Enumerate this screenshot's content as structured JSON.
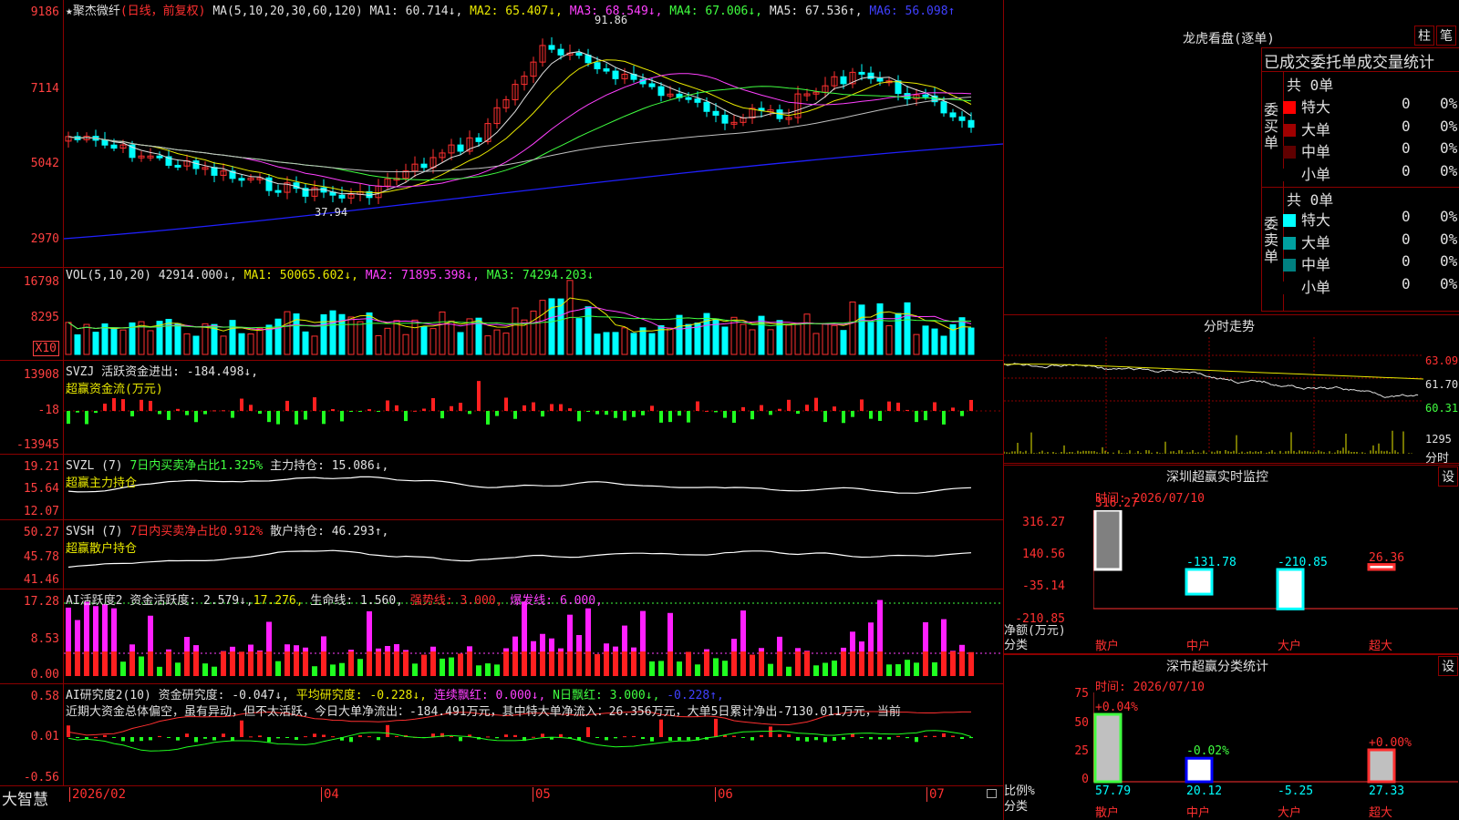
{
  "main": {
    "y_ticks": [
      "9186",
      "7114",
      "5042",
      "2970"
    ],
    "header": {
      "star": "★",
      "name": "聚杰微纤",
      "period": "(日线，前复权)",
      "ma_label": "MA(5,10,20,30,60,120)",
      "ma1": "MA1: 60.714↓,",
      "ma2": "MA2: 65.407↓,",
      "ma3": "MA3: 68.549↓,",
      "ma4": "MA4: 67.006↓,",
      "ma5": "MA5: 67.536↑,",
      "ma6": "MA6: 56.098↑"
    },
    "high_label": "91.86",
    "low_label": "37.94"
  },
  "vol": {
    "y_ticks": [
      "16798",
      "8295"
    ],
    "unit": "X10",
    "header": {
      "label": "VOL(5,10,20)",
      "val": "42914.000↓,",
      "ma1": "MA1: 50065.602↓,",
      "ma2": "MA2: 71895.398↓,",
      "ma3": "MA3: 74294.203↓"
    }
  },
  "svzj": {
    "y_ticks": [
      "13908",
      "-18",
      "-13945"
    ],
    "header": {
      "label": "SVZJ",
      "text": "活跃资金进出: -184.498↓,",
      "sub": "超赢资金流(万元)"
    }
  },
  "svzl": {
    "y_ticks": [
      "19.21",
      "15.64",
      "12.07"
    ],
    "header": {
      "label": "SVZL (7)",
      "text1": "7日内买卖净占比1.325%",
      "text2": "主力持仓: 15.086↓,",
      "sub": "超赢主力持仓"
    }
  },
  "svsh": {
    "y_ticks": [
      "50.27",
      "45.78",
      "41.46"
    ],
    "header": {
      "label": "SVSH (7)",
      "text1": "7日内买卖净占比0.912%",
      "text2": "散户持仓: 46.293↑,",
      "sub": "超赢散户持仓"
    }
  },
  "ai2": {
    "y_ticks": [
      "17.28",
      "8.53",
      "0.00"
    ],
    "header": {
      "label": "AI活跃度2",
      "t1": "资金活跃度: 2.579↓,",
      "t2": "17.276,",
      "t3": "生命线: 1.560,",
      "t4": "强势线: 3.000,",
      "t5": "爆发线: 6.000,"
    }
  },
  "ai_r": {
    "y_ticks": [
      "0.58",
      "0.01",
      "-0.56"
    ],
    "header": {
      "label": "AI研究度2(10)",
      "t1": "资金研究度: -0.047↓,",
      "t2": "平均研究度: -0.228↓,",
      "t3": "连续飘红: 0.000↓,",
      "t4": "N日飘红: 3.000↓,",
      "t5": "-0.228↑,"
    },
    "comment": "近期大资金总体偏空，虽有异动，但不太活跃，今日大单净流出：-184.491万元，其中特大单净流入：26.356万元，大单5日累计净出-7130.011万元，当前"
  },
  "xaxis": {
    "brand": "大智慧",
    "labels": [
      "2026/02",
      "04",
      "05",
      "06",
      "07"
    ]
  },
  "lhb": {
    "title": "龙虎看盘(逐单)",
    "btn1": "柱",
    "btn2": "笔",
    "col_header": "已成交委托单成交量统计",
    "buy_label": "委买单",
    "sell_label": "委卖单",
    "buy_total": "共 0单",
    "sell_total": "共 0单",
    "buy_rows": [
      {
        "name": "特大",
        "val": "0",
        "pct": "0%",
        "color": "#ff0000"
      },
      {
        "name": "大单",
        "val": "0",
        "pct": "0%",
        "color": "#a00000"
      },
      {
        "name": "中单",
        "val": "0",
        "pct": "0%",
        "color": "#600000"
      },
      {
        "name": "小单",
        "val": "0",
        "pct": "0%",
        "color": "#000000"
      }
    ],
    "sell_rows": [
      {
        "name": "特大",
        "val": "0",
        "pct": "0%",
        "color": "#00ffff"
      },
      {
        "name": "大单",
        "val": "0",
        "pct": "0%",
        "color": "#00a0a0"
      },
      {
        "name": "中单",
        "val": "0",
        "pct": "0%",
        "color": "#008080"
      },
      {
        "name": "小单",
        "val": "0",
        "pct": "0%",
        "color": "#000000"
      }
    ]
  },
  "intraday": {
    "title": "分时走势",
    "y_labels": [
      "63.09",
      "61.70",
      "60.31",
      "1295"
    ],
    "x_label": "分时"
  },
  "sz_monitor": {
    "title": "深圳超赢实时监控",
    "btn": "设",
    "date": "时间: 2026/07/10",
    "y_ticks": [
      "316.27",
      "140.56",
      "-35.14",
      "-210.85"
    ],
    "ylabel1": "净额(万元)",
    "ylabel2": "分类",
    "values": [
      "316.27",
      "-131.78",
      "-210.85",
      "26.36"
    ],
    "cats": [
      "散户",
      "中户",
      "大户",
      "超大"
    ]
  },
  "sz_stats": {
    "title": "深市超赢分类统计",
    "btn": "设",
    "date": "时间: 2026/07/10",
    "y_ticks": [
      "75",
      "50",
      "25",
      "0"
    ],
    "ylabel1": "比例%",
    "ylabel2": "分类",
    "pct_labels": [
      "+0.04%",
      "-0.02%",
      "",
      "+0.00%"
    ],
    "values": [
      "57.79",
      "20.12",
      "-5.25",
      "27.33"
    ],
    "cats": [
      "散户",
      "中户",
      "大户",
      "超大"
    ]
  }
}
